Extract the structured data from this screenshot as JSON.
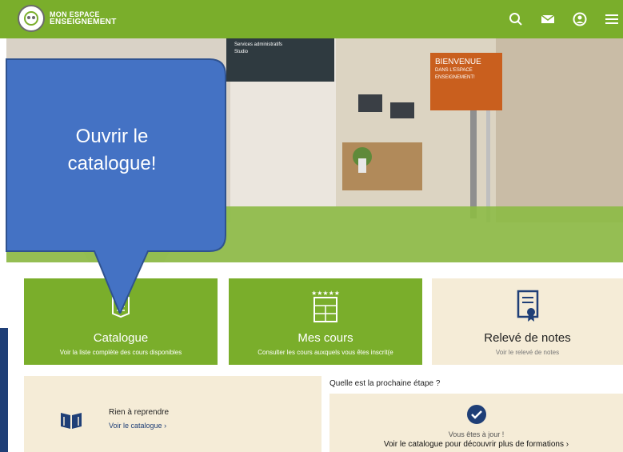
{
  "brand": {
    "line1": "MON ESPACE",
    "line2": "ENSEIGNEMENT"
  },
  "header": {
    "icons": [
      "search-icon",
      "mail-icon",
      "user-icon",
      "menu-icon"
    ]
  },
  "hero": {
    "board_line1": "Services administratifs",
    "board_line2": "Studio",
    "sign_line1": "BIENVENUE",
    "sign_line2": "DANS L'ESPACE",
    "sign_line3": "ENSEIGNEMENT!"
  },
  "callout": {
    "line1": "Ouvrir le",
    "line2": "catalogue!"
  },
  "cards": [
    {
      "title": "Catalogue",
      "subtitle": "Voir la liste complète des cours disponibles",
      "icon": "catalog-icon",
      "style": "green"
    },
    {
      "title": "Mes cours",
      "subtitle": "Consulter les cours auxquels vous êtes inscrit(e",
      "icon": "courses-icon",
      "style": "green"
    },
    {
      "title": "Relevé de notes",
      "subtitle": "Voir le relevé de notes",
      "icon": "certificate-icon",
      "style": "cream"
    }
  ],
  "resume": {
    "title": "Rien à reprendre",
    "link": "Voir le catalogue"
  },
  "next_step": {
    "heading": "Quelle est la prochaine étape ?",
    "status": "Vous êtes à jour !",
    "link": "Voir le catalogue pour découvrir plus de formations"
  },
  "colors": {
    "green": "#7aae2b",
    "cream": "#f5ecd7",
    "navy": "#1f3f77",
    "callout": "#4472c4"
  }
}
